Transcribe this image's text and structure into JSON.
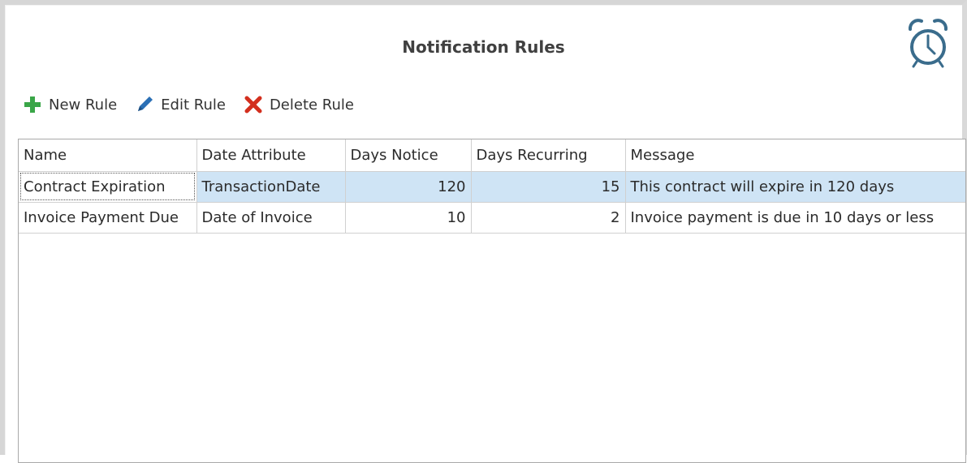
{
  "window": {
    "title": "Notification Rules",
    "icon": "alarm-clock-icon"
  },
  "toolbar": {
    "new_rule": "New Rule",
    "edit_rule": "Edit Rule",
    "delete_rule": "Delete Rule"
  },
  "grid": {
    "columns": [
      "Name",
      "Date Attribute",
      "Days Notice",
      "Days Recurring",
      "Message"
    ],
    "rows": [
      {
        "name": "Contract Expiration",
        "date_attribute": "TransactionDate",
        "days_notice": "120",
        "days_recurring": "15",
        "message": "This contract will expire in 120 days",
        "selected": true
      },
      {
        "name": "Invoice Payment Due",
        "date_attribute": "Date of Invoice",
        "days_notice": "10",
        "days_recurring": "2",
        "message": "Invoice payment is due in 10 days or less",
        "selected": false
      }
    ]
  },
  "colors": {
    "selection": "#cfe4f5",
    "add_icon": "#3aa648",
    "edit_icon": "#2a6fb5",
    "delete_icon": "#d32f1e"
  }
}
